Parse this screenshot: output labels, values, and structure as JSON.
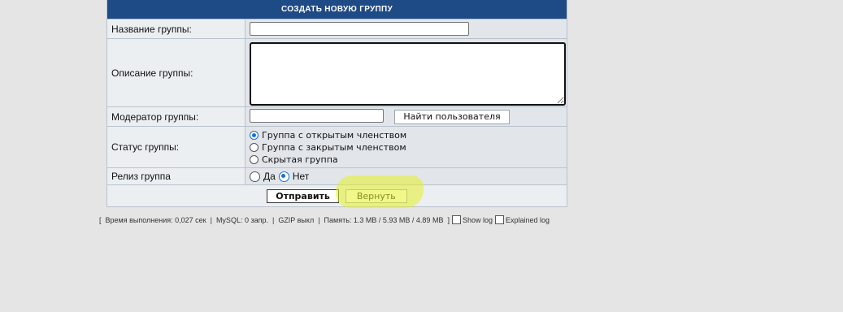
{
  "panel": {
    "title": "СОЗДАТЬ НОВУЮ ГРУППУ"
  },
  "form": {
    "name_label": "Название группы:",
    "name_value": "",
    "description_label": "Описание группы:",
    "description_value": "",
    "moderator_label": "Модератор группы:",
    "moderator_value": "",
    "find_user_button": "Найти пользователя",
    "status_label": "Статус группы:",
    "status_options": [
      "Группа с открытым членством",
      "Группа с закрытым членством",
      "Скрытая группа"
    ],
    "status_selected": "Группа с открытым членством",
    "release_label": "Релиз группа",
    "release_options": [
      "Да",
      "Нет"
    ],
    "release_selected": "Нет",
    "submit_button": "Отправить",
    "back_button": "Вернуть"
  },
  "footer": {
    "open_bracket": "[",
    "exec_time": "Время выполнения: 0,027 сек",
    "mysql": "MySQL: 0 запр.",
    "gzip": "GZIP выкл",
    "memory": "Память: 1.3 MB / 5.93 MB / 4.89 MB",
    "close_bracket": "]",
    "show_log": "Show log",
    "explained_log": "Explained log"
  },
  "colors": {
    "header_bg": "#1e4a86",
    "highlight": "#e6f028"
  }
}
